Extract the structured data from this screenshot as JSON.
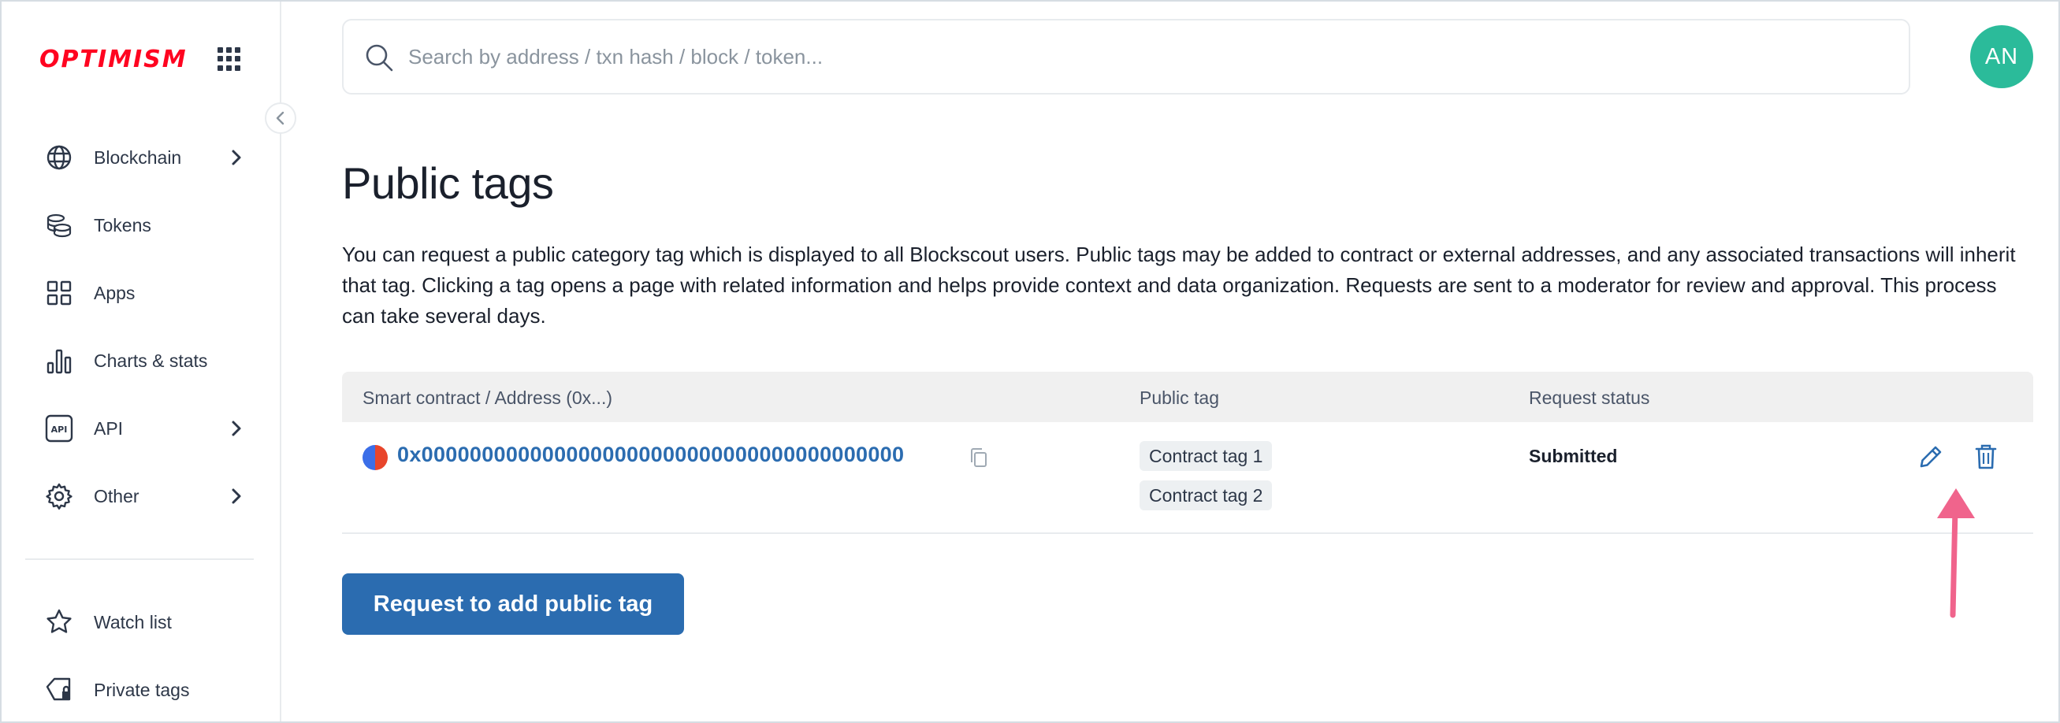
{
  "brand": {
    "logo_text": "OPTIMISM",
    "logo_color": "#ff0420"
  },
  "sidebar": {
    "items": [
      {
        "label": "Blockchain",
        "icon": "globe-icon",
        "has_submenu": true
      },
      {
        "label": "Tokens",
        "icon": "coins-icon",
        "has_submenu": false
      },
      {
        "label": "Apps",
        "icon": "apps-grid-icon",
        "has_submenu": false
      },
      {
        "label": "Charts & stats",
        "icon": "bar-chart-icon",
        "has_submenu": false
      },
      {
        "label": "API",
        "icon": "api-icon",
        "has_submenu": true
      },
      {
        "label": "Other",
        "icon": "gear-icon",
        "has_submenu": true
      }
    ],
    "account_items": [
      {
        "label": "Watch list",
        "icon": "star-icon"
      },
      {
        "label": "Private tags",
        "icon": "private-tag-icon"
      }
    ]
  },
  "header": {
    "search": {
      "placeholder": "Search by address / txn hash / block / token...",
      "value": ""
    },
    "avatar_initials": "AN",
    "avatar_color": "#2bbb9a"
  },
  "main": {
    "title": "Public tags",
    "description": "You can request a public category tag which is displayed to all Blockscout users. Public tags may be added to contract or external addresses, and any associated transactions will inherit that tag. Clicking a tag opens a page with related information and helps provide context and data organization. Requests are sent to a moderator for review and approval. This process can take several days.",
    "table": {
      "columns": [
        "Smart contract / Address (0x...)",
        "Public tag",
        "Request status"
      ],
      "rows": [
        {
          "address": "0x0000000000000000000000000000000000000000",
          "tags": [
            "Contract tag 1",
            "Contract tag 2"
          ],
          "status": "Submitted"
        }
      ]
    },
    "primary_button_label": "Request to add public tag"
  },
  "colors": {
    "accent": "#2b6cb0",
    "annotation_arrow": "#f0648c"
  }
}
